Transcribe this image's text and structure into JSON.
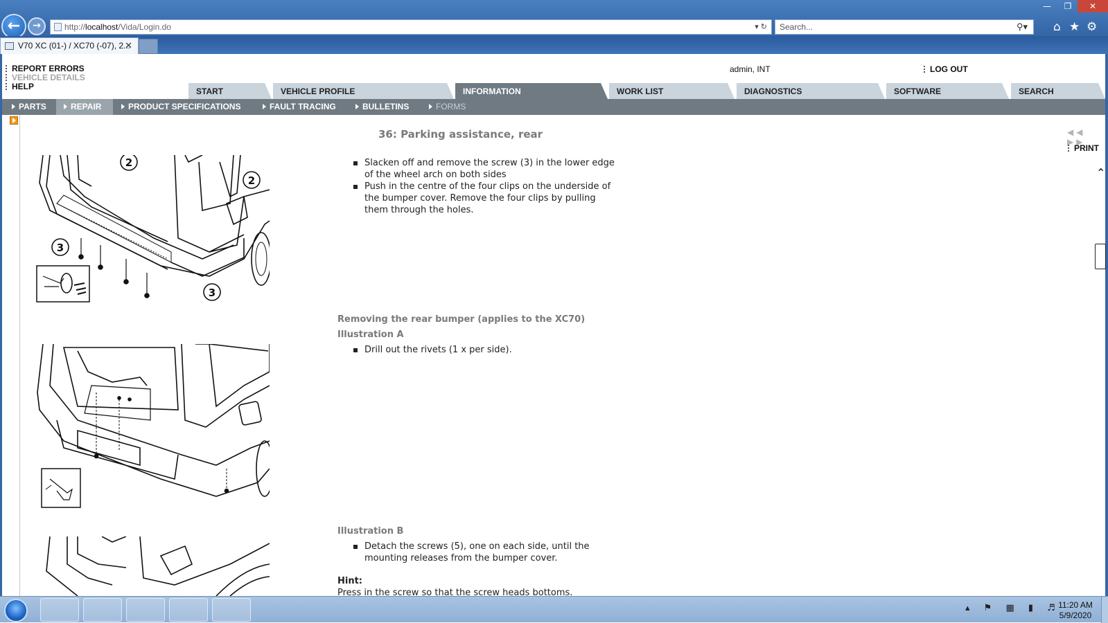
{
  "browser": {
    "address": {
      "prefix": "http://",
      "host": "localhost",
      "path": "/Vida/Login.do"
    },
    "search_placeholder": "Search...",
    "tab_title": "V70 XC (01-) / XC70 (-07), 2..."
  },
  "header": {
    "links": [
      "REPORT ERRORS",
      "VEHICLE DETAILS",
      "HELP"
    ],
    "user": "admin, INT",
    "logout": "LOG OUT"
  },
  "main_tabs": [
    "START",
    "VEHICLE PROFILE",
    "INFORMATION",
    "WORK LIST",
    "DIAGNOSTICS",
    "SOFTWARE",
    "SEARCH"
  ],
  "sub_nav": [
    "PARTS",
    "REPAIR",
    "PRODUCT SPECIFICATIONS",
    "FAULT TRACING",
    "BULLETINS",
    "FORMS"
  ],
  "doc": {
    "title": "36: Parking assistance, rear",
    "print": "PRINT",
    "step1_items": [
      "Slacken off and remove the screw (3) in the lower edge of the wheel arch on both sides",
      "Push in the centre of the four clips on the underside of the bumper cover. Remove the four clips by pulling them through the holes."
    ],
    "section2_title": "Removing the rear bumper (applies to the XC70)",
    "illus_a_title": "Illustration A",
    "illus_a_items": [
      "Drill out the rivets (1 x per side)."
    ],
    "illus_b_title": "Illustration B",
    "illus_b_items": [
      "Detach the screws (5), one on each side, until the mounting releases from the bumper cover."
    ],
    "hint_label": "Hint:",
    "hint_text": "Press in the screw so that the screw heads bottoms.",
    "callouts": [
      "2",
      "2",
      "3",
      "3"
    ]
  },
  "taskbar": {
    "time": "11:20 AM",
    "date": "5/9/2020"
  }
}
